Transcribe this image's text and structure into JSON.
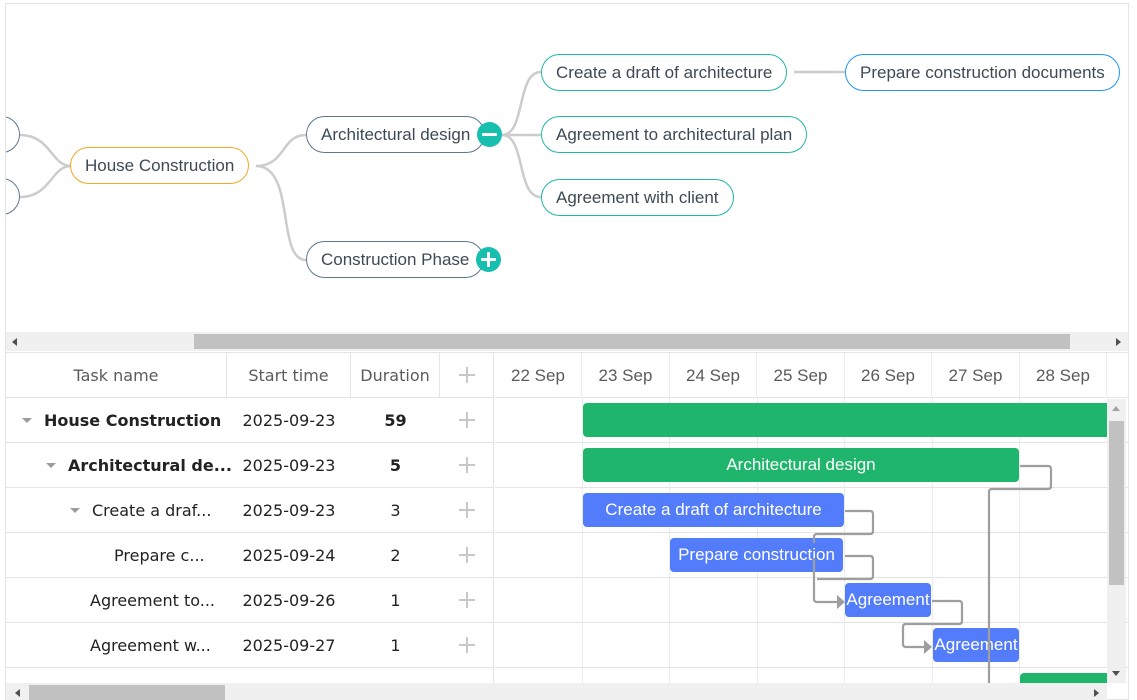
{
  "mindmap": {
    "root": {
      "label": "House Construction",
      "border_color": "#f5a623"
    },
    "left_stubs": [
      "",
      ""
    ],
    "level1": [
      {
        "label": "Architectural design",
        "toggle": "collapse"
      },
      {
        "label": "Construction Phase",
        "toggle": "expand"
      }
    ],
    "level2": [
      {
        "label": "Create a draft of architecture"
      },
      {
        "label": "Agreement to architectural plan"
      },
      {
        "label": "Agreement with client"
      }
    ],
    "level3": [
      {
        "label": "Prepare construction documents"
      }
    ],
    "colors": {
      "link": "#cccccc",
      "toggle": "#17bfae",
      "teal_border": "#20b7aa",
      "blue_border": "#2196f3"
    }
  },
  "gantt": {
    "columns": [
      {
        "label": "Task name"
      },
      {
        "label": "Start time"
      },
      {
        "label": "Duration"
      },
      {
        "label": "+",
        "icon": "add-icon"
      }
    ],
    "scale": [
      "22 Sep",
      "23 Sep",
      "24 Sep",
      "25 Sep",
      "26 Sep",
      "27 Sep",
      "28 Sep"
    ],
    "rows": [
      {
        "name": "House Construction",
        "start": "2025-09-23",
        "duration": "59",
        "bold": true,
        "level": 0,
        "expanded": true,
        "type": "project",
        "bar_label": ""
      },
      {
        "name": "Architectural de...",
        "start": "2025-09-23",
        "duration": "5",
        "bold": true,
        "level": 1,
        "expanded": true,
        "type": "project",
        "bar_label": "Architectural design"
      },
      {
        "name": "Create a draf...",
        "start": "2025-09-23",
        "duration": "3",
        "bold": false,
        "level": 2,
        "expanded": true,
        "type": "task",
        "bar_label": "Create a draft of architecture"
      },
      {
        "name": "Prepare c...",
        "start": "2025-09-24",
        "duration": "2",
        "bold": false,
        "level": 3,
        "expanded": null,
        "type": "task",
        "bar_label": "Prepare construction"
      },
      {
        "name": "Agreement to...",
        "start": "2025-09-26",
        "duration": "1",
        "bold": false,
        "level": 2,
        "expanded": null,
        "type": "task",
        "bar_label": "Agreement"
      },
      {
        "name": "Agreement w...",
        "start": "2025-09-27",
        "duration": "1",
        "bold": false,
        "level": 2,
        "expanded": null,
        "type": "task",
        "bar_label": "Agreement"
      }
    ],
    "colors": {
      "project": "#20b56d",
      "task": "#537cfa",
      "link": "#9e9e9e"
    }
  }
}
